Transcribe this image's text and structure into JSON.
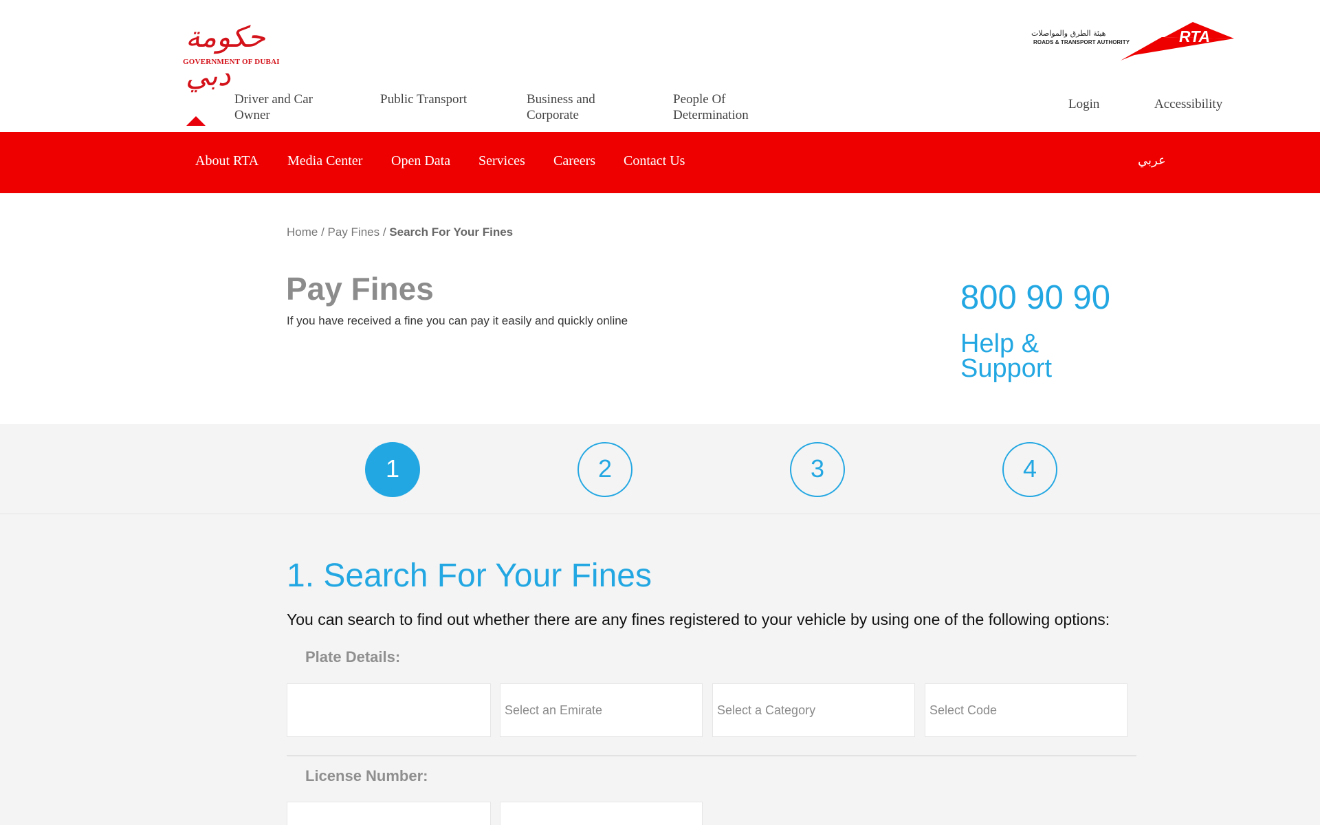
{
  "header": {
    "gov_logo": {
      "arabic": "حكومة دبي",
      "english": "GOVERNMENT OF DUBAI"
    },
    "rta_logo": {
      "arabic": "هيئة الطرق والمواصلات",
      "english": "ROADS & TRANSPORT AUTHORITY",
      "mark": "RTA"
    },
    "top_nav": [
      {
        "label": "Driver and Car\nOwner"
      },
      {
        "label": "Public Transport"
      },
      {
        "label": "Business and\nCorporate"
      },
      {
        "label": "People Of\nDetermination"
      }
    ],
    "login_label": "Login",
    "accessibility_label": "Accessibility"
  },
  "red_nav": {
    "items": [
      "About RTA",
      "Media Center",
      "Open Data",
      "Services",
      "Careers",
      "Contact Us"
    ],
    "language": "عربي"
  },
  "breadcrumb": {
    "home": "Home",
    "sep": " / ",
    "pay_fines": "Pay Fines",
    "current": "Search For Your Fines"
  },
  "page": {
    "title": "Pay Fines",
    "subtitle": "If you have received a fine you can pay it easily and quickly online",
    "phone": "800 90 90",
    "help": "Help & Support"
  },
  "steps": [
    "1",
    "2",
    "3",
    "4"
  ],
  "active_step": "1",
  "section": {
    "title": "1. Search For Your Fines",
    "description": "You can search to find out whether there are any fines registered to your vehicle by using one of the following options:",
    "plate_label": "Plate Details:",
    "plate_fields": {
      "number_value": "",
      "emirate_placeholder": "Select an Emirate",
      "category_placeholder": "Select a Category",
      "code_placeholder": "Select Code"
    },
    "license_label": "License Number:"
  },
  "colors": {
    "brand_red": "#ee0000",
    "accent_blue": "#23a7e2",
    "band_gray": "#f4f4f4"
  }
}
